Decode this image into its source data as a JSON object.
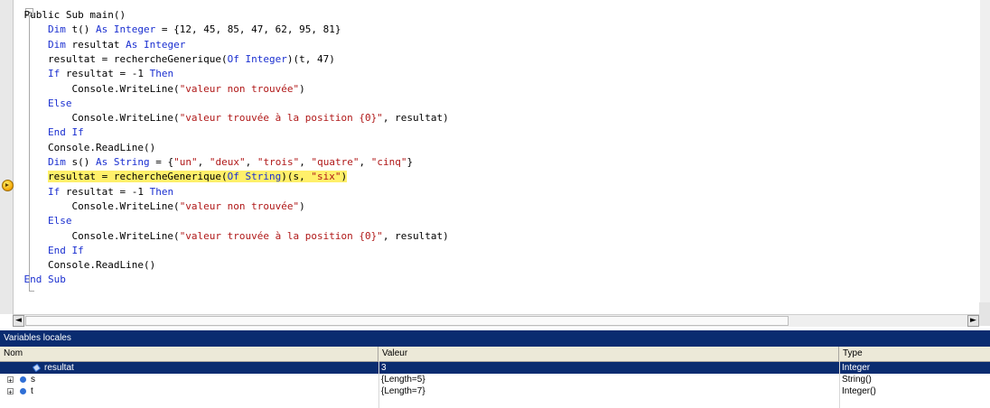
{
  "editor": {
    "outline_toggle": "−",
    "lines": [
      [
        {
          "t": "    Public Sub main()",
          "c": ""
        }
      ],
      [
        {
          "t": "        Dim",
          "c": "kw"
        },
        {
          "t": " t() ",
          "c": ""
        },
        {
          "t": "As",
          "c": "kw"
        },
        {
          "t": " ",
          "c": ""
        },
        {
          "t": "Integer",
          "c": "kw"
        },
        {
          "t": " = {12, 45, 85, 47, 62, 95, 81}",
          "c": ""
        }
      ],
      [
        {
          "t": "        Dim",
          "c": "kw"
        },
        {
          "t": " resultat ",
          "c": ""
        },
        {
          "t": "As",
          "c": "kw"
        },
        {
          "t": " ",
          "c": ""
        },
        {
          "t": "Integer",
          "c": "kw"
        }
      ],
      [
        {
          "t": "        resultat = rechercheGenerique(",
          "c": ""
        },
        {
          "t": "Of",
          "c": "kw"
        },
        {
          "t": " ",
          "c": ""
        },
        {
          "t": "Integer",
          "c": "kw"
        },
        {
          "t": ")(t, 47)",
          "c": ""
        }
      ],
      [
        {
          "t": "        If",
          "c": "kw"
        },
        {
          "t": " resultat = -1 ",
          "c": ""
        },
        {
          "t": "Then",
          "c": "kw"
        }
      ],
      [
        {
          "t": "            Console.WriteLine(",
          "c": ""
        },
        {
          "t": "\"valeur non trouvée\"",
          "c": "str"
        },
        {
          "t": ")",
          "c": ""
        }
      ],
      [
        {
          "t": "        Else",
          "c": "kw"
        }
      ],
      [
        {
          "t": "            Console.WriteLine(",
          "c": ""
        },
        {
          "t": "\"valeur trouvée à la position {0}\"",
          "c": "str"
        },
        {
          "t": ", resultat)",
          "c": ""
        }
      ],
      [
        {
          "t": "        End If",
          "c": "kw"
        }
      ],
      [
        {
          "t": "        Console.ReadLine()",
          "c": ""
        }
      ],
      [
        {
          "t": "        Dim",
          "c": "kw"
        },
        {
          "t": " s() ",
          "c": ""
        },
        {
          "t": "As",
          "c": "kw"
        },
        {
          "t": " ",
          "c": ""
        },
        {
          "t": "String",
          "c": "kw"
        },
        {
          "t": " = {",
          "c": ""
        },
        {
          "t": "\"un\"",
          "c": "str"
        },
        {
          "t": ", ",
          "c": ""
        },
        {
          "t": "\"deux\"",
          "c": "str"
        },
        {
          "t": ", ",
          "c": ""
        },
        {
          "t": "\"trois\"",
          "c": "str"
        },
        {
          "t": ", ",
          "c": ""
        },
        {
          "t": "\"quatre\"",
          "c": "str"
        },
        {
          "t": ", ",
          "c": ""
        },
        {
          "t": "\"cinq\"",
          "c": "str"
        },
        {
          "t": "}",
          "c": ""
        }
      ],
      [
        {
          "t": "        ",
          "c": ""
        },
        {
          "t": "resultat = rechercheGenerique(",
          "c": "hl"
        },
        {
          "t": "Of",
          "c": "kw hl"
        },
        {
          "t": " ",
          "c": "hl"
        },
        {
          "t": "String",
          "c": "kw hl"
        },
        {
          "t": ")(s, ",
          "c": "hl"
        },
        {
          "t": "\"six\"",
          "c": "str hl"
        },
        {
          "t": ")",
          "c": "hl"
        }
      ],
      [
        {
          "t": "        If",
          "c": "kw"
        },
        {
          "t": " resultat = -1 ",
          "c": ""
        },
        {
          "t": "Then",
          "c": "kw"
        }
      ],
      [
        {
          "t": "            Console.WriteLine(",
          "c": ""
        },
        {
          "t": "\"valeur non trouvée\"",
          "c": "str"
        },
        {
          "t": ")",
          "c": ""
        }
      ],
      [
        {
          "t": "        Else",
          "c": "kw"
        }
      ],
      [
        {
          "t": "            Console.WriteLine(",
          "c": ""
        },
        {
          "t": "\"valeur trouvée à la position {0}\"",
          "c": "str"
        },
        {
          "t": ", resultat)",
          "c": ""
        }
      ],
      [
        {
          "t": "        End If",
          "c": "kw"
        }
      ],
      [
        {
          "t": "        Console.ReadLine()",
          "c": ""
        }
      ],
      [
        {
          "t": "    End Sub",
          "c": "kw"
        }
      ]
    ],
    "current_line_index": 11
  },
  "hscroll": {
    "left_arrow": "◄",
    "right_arrow": "►"
  },
  "locals": {
    "title": "Variables locales",
    "columns": {
      "name": "Nom",
      "value": "Valeur",
      "type": "Type"
    },
    "rows": [
      {
        "name": "resultat",
        "value": "3",
        "type": "Integer",
        "expandable": false,
        "selected": true
      },
      {
        "name": "s",
        "value": "{Length=5}",
        "type": "String()",
        "expandable": true,
        "selected": false
      },
      {
        "name": "t",
        "value": "{Length=7}",
        "type": "Integer()",
        "expandable": true,
        "selected": false
      }
    ],
    "expand_glyph": "+"
  }
}
